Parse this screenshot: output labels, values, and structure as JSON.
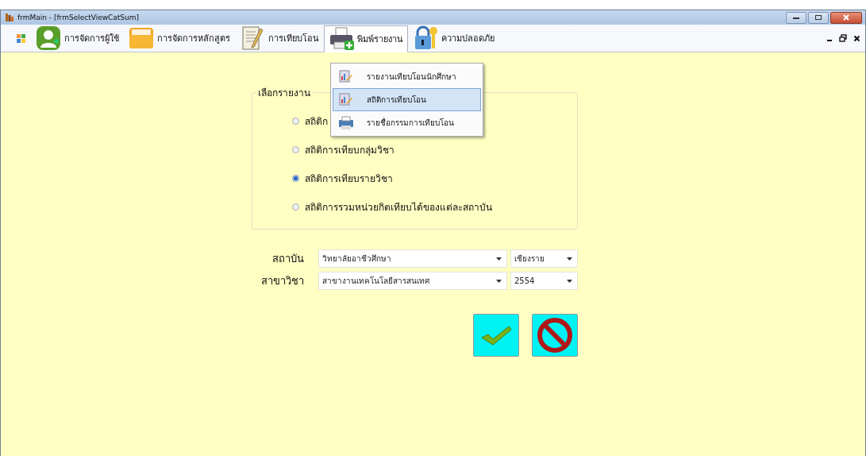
{
  "window": {
    "title": "frmMain - [frmSelectViewCatSum]"
  },
  "menu": {
    "items": [
      {
        "kind": "user",
        "label": "การจัดการผู้ใช้",
        "selected": false
      },
      {
        "kind": "folder",
        "label": "การจัดการหลักสูตร",
        "selected": false
      },
      {
        "kind": "notepad",
        "label": "การเทียบโอน",
        "selected": false
      },
      {
        "kind": "printer",
        "label": "พิมพ์รายงาน",
        "selected": true
      },
      {
        "kind": "lock",
        "label": "ความปลอดภัย",
        "selected": false
      }
    ]
  },
  "dropdown": {
    "items": [
      {
        "kind": "report",
        "label": "รายงานเทียบโอนนักศึกษา",
        "selected": false
      },
      {
        "kind": "report",
        "label": "สถิติการเทียบโอน",
        "selected": true
      },
      {
        "kind": "printer",
        "label": "รายชื่อกรรมการเทียบโอน",
        "selected": false
      }
    ]
  },
  "report_group": {
    "title": "เลือกรายงาน",
    "options": [
      {
        "label": "สถิติก",
        "selected": false
      },
      {
        "label": "สถิติการเทียบกลุ่มวิชา",
        "selected": false
      },
      {
        "label": "สถิติการเทียบรายวิชา",
        "selected": true
      },
      {
        "label": "สถิติการรวมหน่วยกิตเทียบได้ของแต่ละสถาบัน",
        "selected": false
      }
    ]
  },
  "fields": [
    {
      "label": "สถาบัน",
      "value": "วิทยาลัยอาชีวศึกษา",
      "value_2": "เชียงราย"
    },
    {
      "label": "สาขาวิชา",
      "value": "สาขางานเทคโนโลยีสารสนเทศ",
      "value_2": "2554"
    }
  ]
}
